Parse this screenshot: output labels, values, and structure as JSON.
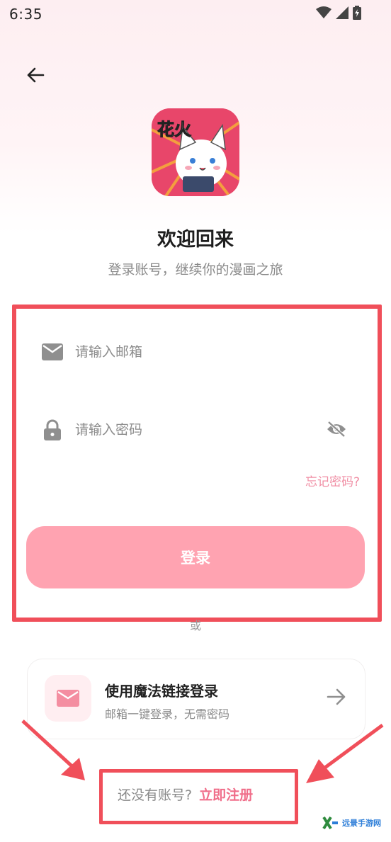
{
  "status_bar": {
    "time": "6:35"
  },
  "header": {
    "back_icon": "arrow-left-icon"
  },
  "logo": {
    "text": "花火",
    "alt": "app-logo"
  },
  "welcome": {
    "title": "欢迎回来",
    "subtitle": "登录账号，继续你的漫画之旅"
  },
  "form": {
    "email": {
      "placeholder": "请输入邮箱",
      "value": "",
      "icon": "mail-icon"
    },
    "password": {
      "placeholder": "请输入密码",
      "value": "",
      "icon": "lock-icon",
      "toggle_icon": "eye-off-icon"
    },
    "forgot_label": "忘记密码?",
    "login_label": "登录"
  },
  "divider": {
    "or_label": "或"
  },
  "magic_link": {
    "title": "使用魔法链接登录",
    "subtitle": "邮箱一键登录，无需密码",
    "icon": "mail-icon",
    "arrow_icon": "arrow-right-icon"
  },
  "register": {
    "prompt": "还没有账号?",
    "link_label": "立即注册"
  },
  "watermark": {
    "text": "远景手游网"
  },
  "colors": {
    "accent": "#ffa3b1",
    "link": "#f06e8a",
    "highlight": "#f04f5a",
    "logo_bg": "#e8466a"
  }
}
